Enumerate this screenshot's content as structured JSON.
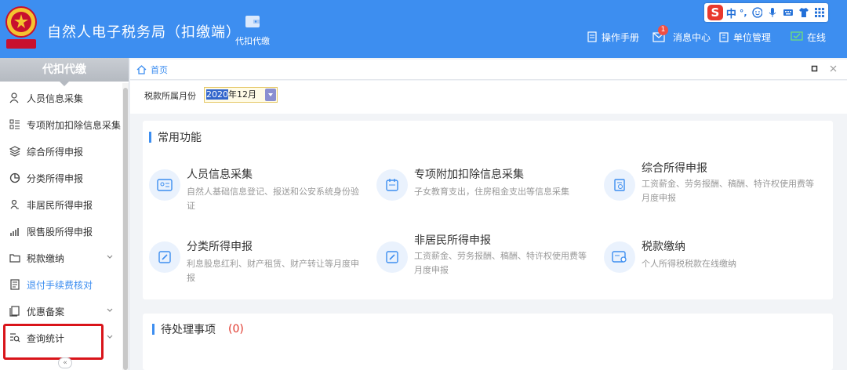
{
  "header": {
    "title": "自然人电子税务局（扣缴端）",
    "module": "代扣代缴",
    "nav": [
      {
        "label": "操作手册",
        "icon": "manual-icon"
      },
      {
        "label": "消息中心",
        "icon": "mail-icon",
        "badge": "1"
      },
      {
        "label": "单位管理",
        "icon": "building-icon"
      },
      {
        "label": "在线",
        "icon": "online-icon"
      }
    ]
  },
  "ime": {
    "logo": "S",
    "mode": "中",
    "punct": "°,"
  },
  "sidebar": {
    "title": "代扣代缴",
    "items": [
      {
        "label": "人员信息采集",
        "icon": "person-icon"
      },
      {
        "label": "专项附加扣除信息采集",
        "icon": "list-icon"
      },
      {
        "label": "综合所得申报",
        "icon": "layers-icon"
      },
      {
        "label": "分类所得申报",
        "icon": "pie-icon"
      },
      {
        "label": "非居民所得申报",
        "icon": "user-icon"
      },
      {
        "label": "限售股所得申报",
        "icon": "chart-icon"
      },
      {
        "label": "税款缴纳",
        "icon": "folder-icon",
        "expandable": true
      },
      {
        "label": "退付手续费核对",
        "icon": "doc-icon",
        "active": true
      },
      {
        "label": "优惠备案",
        "icon": "doc2-icon",
        "expandable": true
      },
      {
        "label": "查询统计",
        "icon": "search-list-icon",
        "expandable": true
      }
    ],
    "collapse": "«"
  },
  "breadcrumb": {
    "home": "首页"
  },
  "toolbar": {
    "label": "税款所属月份",
    "year_selected": "2020",
    "month_rest": "年12月"
  },
  "common": {
    "title": "常用功能",
    "cards": [
      {
        "title": "人员信息采集",
        "desc": "自然人基础信息登记、报送和公安系统身份验证"
      },
      {
        "title": "专项附加扣除信息采集",
        "desc": "子女教育支出，住房租金支出等信息采集"
      },
      {
        "title": "综合所得申报",
        "desc": "工资薪金、劳务报酬、稿酬、特许权使用费等月度申报"
      },
      {
        "title": "分类所得申报",
        "desc": "利息股息红利、财产租赁、财产转让等月度申报"
      },
      {
        "title": "非居民所得申报",
        "desc": "工资薪金、劳务报酬、稿酬、特许权使用费等月度申报"
      },
      {
        "title": "税款缴纳",
        "desc": "个人所得税税款在线缴纳"
      }
    ]
  },
  "pending": {
    "title": "待处理事项",
    "count": "(0)"
  },
  "colors": {
    "primary": "#3d8ef0",
    "highlight": "#d9141a",
    "count": "#e0382d"
  }
}
